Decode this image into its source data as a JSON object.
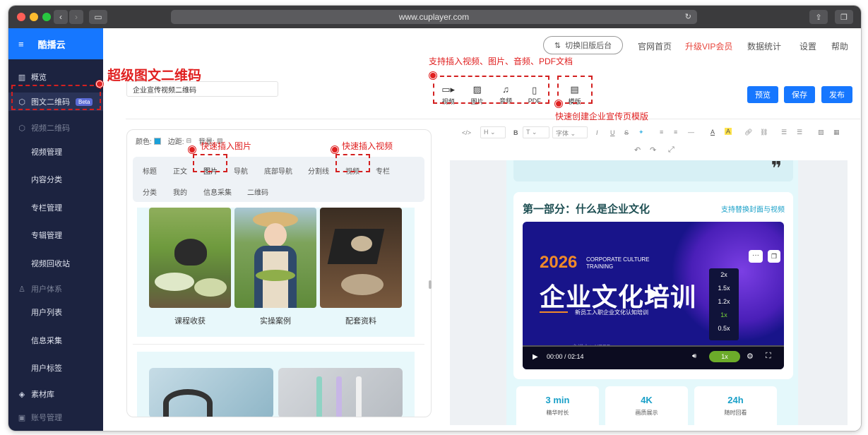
{
  "browser": {
    "url": "www.cuplayer.com"
  },
  "brand": {
    "name": "酷播云",
    "menu_icon": "hamburger-icon"
  },
  "sidebar": {
    "items": [
      {
        "label": "概览",
        "icon": "bar-chart-icon",
        "kind": "top"
      },
      {
        "label": "图文二维码",
        "icon": "cube-icon",
        "badge": "Beta",
        "kind": "top-active"
      },
      {
        "label": "视频二维码",
        "icon": "cube-icon",
        "kind": "group"
      },
      {
        "label": "视频管理",
        "kind": "sub"
      },
      {
        "label": "内容分类",
        "kind": "sub"
      },
      {
        "label": "专栏管理",
        "kind": "sub"
      },
      {
        "label": "专辑管理",
        "kind": "sub"
      },
      {
        "label": "视频回收站",
        "kind": "sub"
      },
      {
        "label": "用户体系",
        "icon": "user-icon",
        "kind": "group"
      },
      {
        "label": "用户列表",
        "kind": "sub"
      },
      {
        "label": "信息采集",
        "kind": "sub"
      },
      {
        "label": "用户标签",
        "kind": "sub"
      },
      {
        "label": "素材库",
        "icon": "layers-icon",
        "kind": "top"
      },
      {
        "label": "账号管理",
        "icon": "account-icon",
        "kind": "group"
      }
    ]
  },
  "topnav": {
    "switch_label": "切换旧版后台",
    "links": [
      "官网首页",
      "升级VIP会员",
      "数据统计",
      "设置",
      "帮助"
    ]
  },
  "editor": {
    "title_value": "企业宣传视频二维码",
    "insert_tools": [
      {
        "label": "视频",
        "icon": "video-icon"
      },
      {
        "label": "图片",
        "icon": "image-icon"
      },
      {
        "label": "音频",
        "icon": "music-icon"
      },
      {
        "label": "PDF",
        "icon": "file-icon"
      }
    ],
    "template_tool": {
      "label": "模版",
      "icon": "template-icon"
    },
    "buttons": {
      "preview": "预览",
      "save": "保存",
      "publish": "发布"
    }
  },
  "annotations": {
    "main": "超级图文二维码",
    "insert": "支持插入视频、图片、音频、PDF文档",
    "template": "快速创建企业宣传页模版",
    "image": "快速插入图片",
    "video": "快速插入视频"
  },
  "panel": {
    "props": {
      "color": "颜色:",
      "margin": "边距:",
      "bg": "背景:"
    },
    "tabs_row1": [
      "标题",
      "正文",
      "图片",
      "导航",
      "底部导航",
      "分割线",
      "视频",
      "专栏"
    ],
    "tabs_row2": [
      "分类",
      "我的",
      "信息采集",
      "二维码"
    ],
    "captions": [
      "课程收获",
      "实操案例",
      "配套资料"
    ]
  },
  "toolbar": {
    "heading": "H",
    "text": "T",
    "font": "字体"
  },
  "preview": {
    "section_title": "第一部分：什么是企业文化",
    "section_link": "支持替换封面与视频",
    "video": {
      "year": "2026",
      "eng1": "CORPORATE CULTURE",
      "eng2": "TRAINING",
      "main": "企业文化培训",
      "sub": "新员工入职企业文化认知培训",
      "lecturer": "主讲人：HRBP",
      "time": "00:00 / 02:14",
      "speeds": [
        "2x",
        "1.5x",
        "1.2x",
        "1x",
        "0.5x"
      ],
      "speed_current": "1x"
    },
    "stats": [
      {
        "value": "3 min",
        "label": "精华时长"
      },
      {
        "value": "4K",
        "label": "画质展示"
      },
      {
        "value": "24h",
        "label": "随时回看"
      }
    ]
  },
  "colors": {
    "accent": "#1677ff",
    "sidebar": "#1c2340",
    "annotation": "#e02020",
    "teal": "#1aa0c8"
  }
}
